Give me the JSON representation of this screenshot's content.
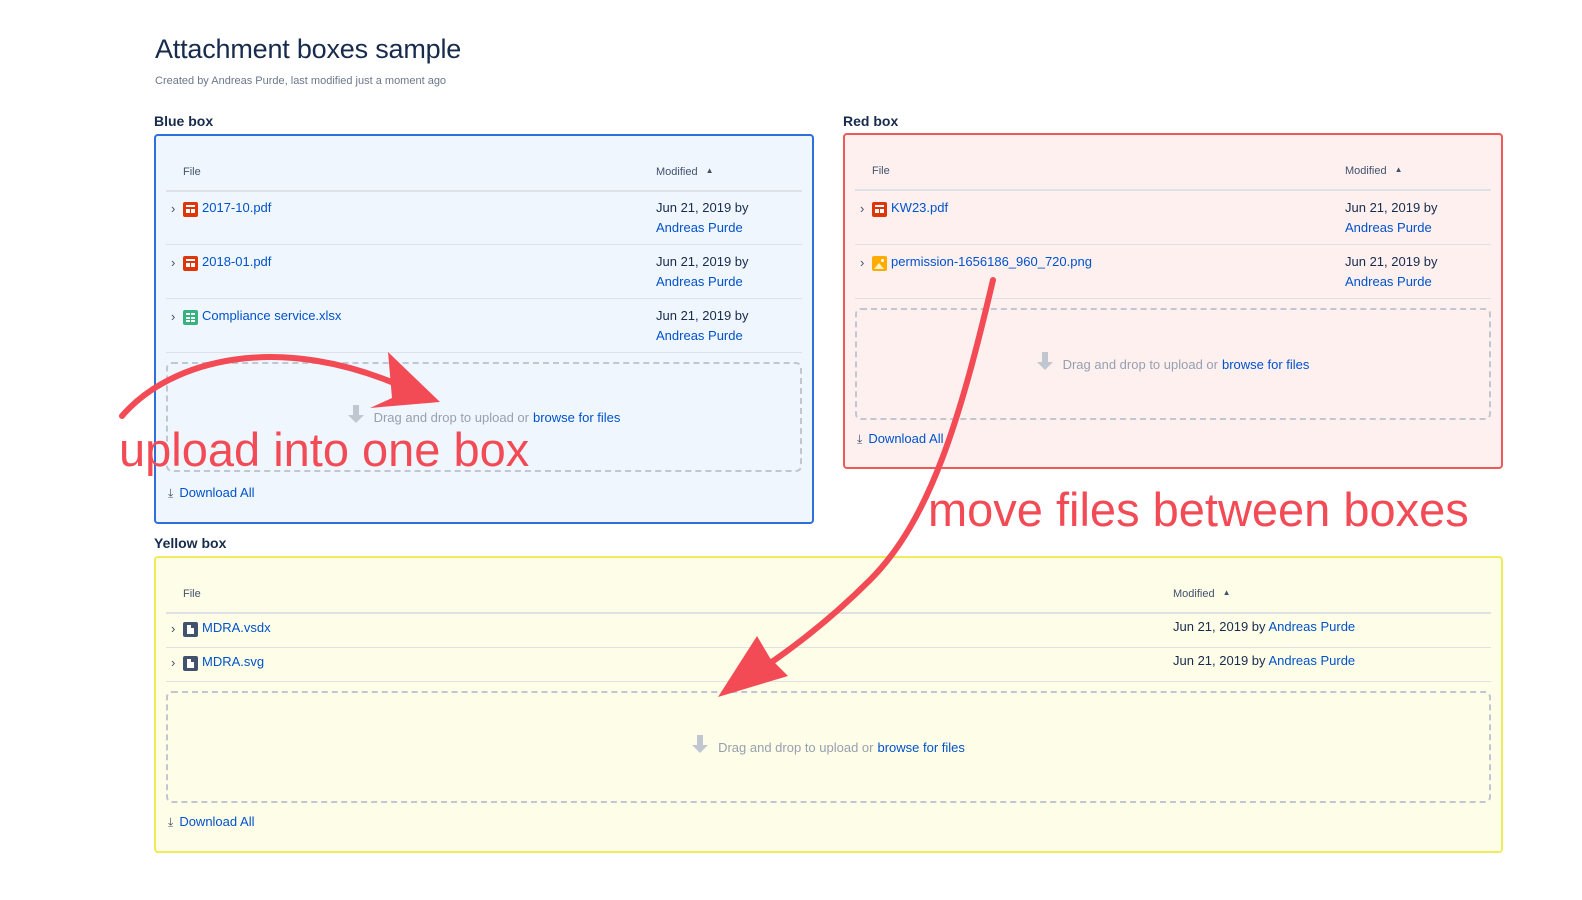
{
  "page": {
    "title": "Attachment boxes sample",
    "meta": "Created by Andreas Purde, last modified just a moment ago"
  },
  "columns": {
    "file": "File",
    "modified": "Modified",
    "sort_icon": "caret-up-icon"
  },
  "boxes": {
    "blue": {
      "label": "Blue box",
      "color": "#2e6fdc",
      "files": [
        {
          "name": "2017-10.pdf",
          "type": "pdf",
          "date": "Jun 21, 2019 by",
          "user": "Andreas Purde"
        },
        {
          "name": "2018-01.pdf",
          "type": "pdf",
          "date": "Jun 21, 2019 by",
          "user": "Andreas Purde"
        },
        {
          "name": "Compliance service.xlsx",
          "type": "xlsx",
          "date": "Jun 21, 2019 by",
          "user": "Andreas Purde"
        }
      ],
      "dropzone": {
        "text": "Drag and drop to upload or",
        "link": "browse for files"
      },
      "download_all": "Download All"
    },
    "red": {
      "label": "Red box",
      "color": "#ee5a5a",
      "files": [
        {
          "name": "KW23.pdf",
          "type": "pdf",
          "date": "Jun 21, 2019 by",
          "user": "Andreas Purde"
        },
        {
          "name": "permission-1656186_960_720.png",
          "type": "png",
          "date": "Jun 21, 2019 by",
          "user": "Andreas Purde"
        }
      ],
      "dropzone": {
        "text": "Drag and drop to upload or",
        "link": "browse for files"
      },
      "download_all": "Download All"
    },
    "yellow": {
      "label": "Yellow box",
      "color": "#f0eb5a",
      "files": [
        {
          "name": "MDRA.vsdx",
          "type": "generic",
          "date": "Jun 21, 2019 by",
          "user": "Andreas Purde"
        },
        {
          "name": "MDRA.svg",
          "type": "generic",
          "date": "Jun 21, 2019 by",
          "user": "Andreas Purde"
        }
      ],
      "dropzone": {
        "text": "Drag and drop to upload or",
        "link": "browse for files"
      },
      "download_all": "Download All"
    }
  },
  "annotations": {
    "upload": "upload into one box",
    "move": "move files between boxes",
    "color": "#f24b55"
  }
}
